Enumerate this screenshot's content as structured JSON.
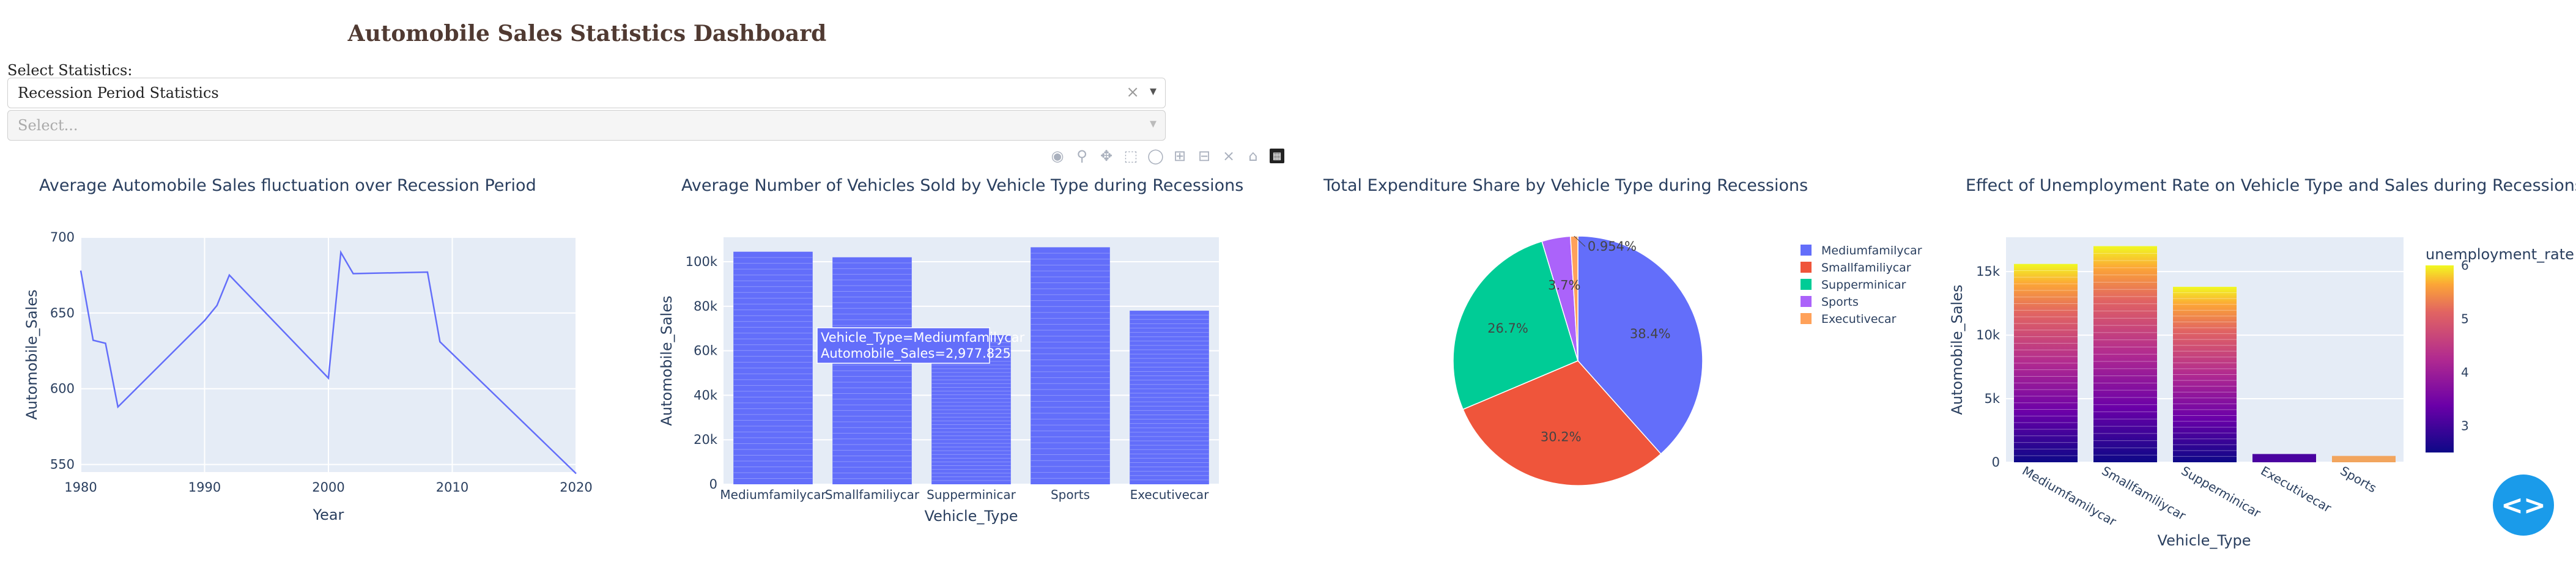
{
  "page": {
    "title": "Automobile Sales Statistics Dashboard",
    "select_label": "Select Statistics:",
    "dropdown1": {
      "value": "Recession Period Statistics",
      "clear": "×",
      "arrow": "▾"
    },
    "dropdown2": {
      "placeholder": "Select...",
      "arrow": "▾"
    }
  },
  "modebar": {
    "icons": [
      "camera-icon",
      "zoom-icon",
      "pan-icon",
      "box-select-icon",
      "lasso-icon",
      "zoom-in-icon",
      "zoom-out-icon",
      "autoscale-icon",
      "reset-axes-icon",
      "plotly-logo-icon"
    ]
  },
  "fab_icon": "code-icon",
  "colors": {
    "line": "#636efa",
    "bar": "#636efa",
    "plot_bg": "#e5ecf6",
    "pie": [
      "#636efa",
      "#ef553b",
      "#00cc96",
      "#ab63fa",
      "#ffa15a"
    ],
    "fab": "#1a9bea"
  },
  "chart_data": [
    {
      "type": "line",
      "title": "Average Automobile Sales fluctuation over Recession Period",
      "xlabel": "Year",
      "ylabel": "Automobile_Sales",
      "xlim": [
        1980,
        2020
      ],
      "ylim": [
        545,
        700
      ],
      "xticks": [
        1980,
        1990,
        2000,
        2010,
        2020
      ],
      "yticks": [
        550,
        600,
        650,
        700
      ],
      "x": [
        1980,
        1981,
        1982,
        1983,
        1990,
        1991,
        1992,
        2000,
        2001,
        2002,
        2008,
        2009,
        2020
      ],
      "y": [
        678,
        632,
        630,
        588,
        645,
        655,
        675,
        607,
        690,
        676,
        677,
        631,
        544
      ],
      "grid": true
    },
    {
      "type": "bar",
      "title": "Average Number of Vehicles Sold by Vehicle Type during Recessions",
      "xlabel": "Vehicle_Type",
      "ylabel": "Automobile_Sales",
      "categories": [
        "Mediumfamilycar",
        "Smallfamiliycar",
        "Supperminicar",
        "Sports",
        "Executivecar"
      ],
      "values": [
        104500,
        102000,
        67000,
        106500,
        78000
      ],
      "ylim": [
        0,
        111000
      ],
      "yticks": [
        0,
        20000,
        40000,
        60000,
        80000,
        100000
      ],
      "ytick_labels": [
        "0",
        "20k",
        "40k",
        "60k",
        "80k",
        "100k"
      ],
      "tooltip": {
        "line1": "Vehicle_Type=Mediumfamilycar",
        "line2": "Automobile_Sales=2,977.825"
      }
    },
    {
      "type": "pie",
      "title": "Total Expenditure Share by Vehicle Type during Recessions",
      "labels": [
        "Mediumfamilycar",
        "Smallfamiliycar",
        "Supperminicar",
        "Sports",
        "Executivecar"
      ],
      "values": [
        38.4,
        30.2,
        26.7,
        3.7,
        0.954
      ],
      "slice_labels": [
        "38.4%",
        "30.2%",
        "26.7%",
        "3.7%",
        "0.954%"
      ],
      "legend": "right"
    },
    {
      "type": "bar",
      "title": "Effect of Unemployment Rate on Vehicle Type and Sales during Recessions",
      "xlabel": "Vehicle_Type",
      "ylabel": "Automobile_Sales",
      "categories": [
        "Mediumfamilycar",
        "Smallfamiliycar",
        "Supperminicar",
        "Executivecar",
        "Sports"
      ],
      "values": [
        15600,
        17000,
        13800,
        650,
        500
      ],
      "ylim": [
        0,
        17700
      ],
      "yticks": [
        0,
        5000,
        10000,
        15000
      ],
      "ytick_labels": [
        "0",
        "5k",
        "10k",
        "15k"
      ],
      "colorbar": {
        "title": "unemployment_rate",
        "range": [
          2.5,
          6
        ],
        "ticks": [
          3,
          4,
          5,
          6
        ]
      }
    }
  ]
}
